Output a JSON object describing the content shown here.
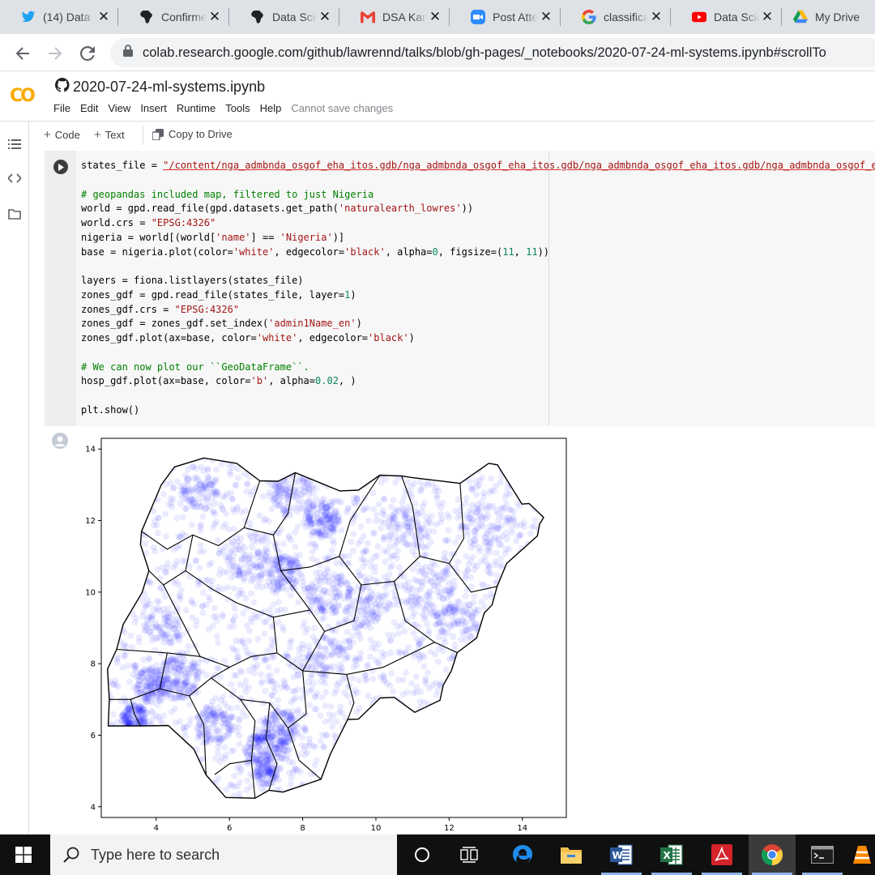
{
  "browser": {
    "tabs": [
      {
        "title": "(14) Data",
        "icon": "twitter-icon"
      },
      {
        "title": "Confirmed",
        "icon": "africa-map-icon"
      },
      {
        "title": "Data Science",
        "icon": "africa-map-icon"
      },
      {
        "title": "DSA Kano",
        "icon": "gmail-icon"
      },
      {
        "title": "Post Attendee",
        "icon": "zoom-icon"
      },
      {
        "title": "classification",
        "icon": "google-icon"
      },
      {
        "title": "Data Science",
        "icon": "youtube-icon"
      },
      {
        "title": "My Drive",
        "icon": "google-drive-icon"
      }
    ],
    "url": "colab.research.google.com/github/lawrennd/talks/blob/gh-pages/_notebooks/2020-07-24-ml-systems.ipynb#scrollTo"
  },
  "colab": {
    "logo": "CO",
    "notebook_title": "2020-07-24-ml-systems.ipynb",
    "menu": [
      "File",
      "Edit",
      "View",
      "Insert",
      "Runtime",
      "Tools",
      "Help"
    ],
    "save_status": "Cannot save changes",
    "toolbar": {
      "code_label": "Code",
      "text_label": "Text",
      "copy_label": "Copy to Drive"
    }
  },
  "cell": {
    "code_lines": [
      "states_file = \"/content/nga_admbnda_osgof_eha_itos.gdb/nga_admbnda_osgof_eha_itos.gdb/nga_admbnda_osgof_eha_itos.gdb/nga_admbnda_osgof_e",
      "",
      "# geopandas included map, filtered to just Nigeria",
      "world = gpd.read_file(gpd.datasets.get_path('naturalearth_lowres'))",
      "world.crs = \"EPSG:4326\"",
      "nigeria = world[(world['name'] == 'Nigeria')]",
      "base = nigeria.plot(color='white', edgecolor='black', alpha=0, figsize=(11, 11))",
      "",
      "layers = fiona.listlayers(states_file)",
      "zones_gdf = gpd.read_file(states_file, layer=1)",
      "zones_gdf.crs = \"EPSG:4326\"",
      "zones_gdf = zones_gdf.set_index('admin1Name_en')",
      "zones_gdf.plot(ax=base, color='white', edgecolor='black')",
      "",
      "# We can now plot our ``GeoDataFrame``.",
      "hosp_gdf.plot(ax=base, color='b', alpha=0.02, )",
      "",
      "plt.show()"
    ]
  },
  "chart_data": {
    "type": "scatter",
    "x_ticks": [
      4,
      6,
      8,
      10,
      12,
      14
    ],
    "y_ticks": [
      4,
      6,
      8,
      10,
      12,
      14
    ],
    "xlim": [
      2.5,
      15.2
    ],
    "ylim": [
      3.7,
      14.3
    ],
    "marker_color": "#0000ff",
    "marker_alpha": 0.02,
    "outline_color": "#000000",
    "grid": false,
    "notes": ""
  },
  "taskbar": {
    "search_placeholder": "Type here to search",
    "apps": [
      "task-view-icon",
      "edge-icon",
      "file-explorer-icon",
      "word-icon",
      "excel-icon",
      "acrobat-icon",
      "chrome-icon",
      "terminal-icon",
      "vlc-icon"
    ]
  }
}
